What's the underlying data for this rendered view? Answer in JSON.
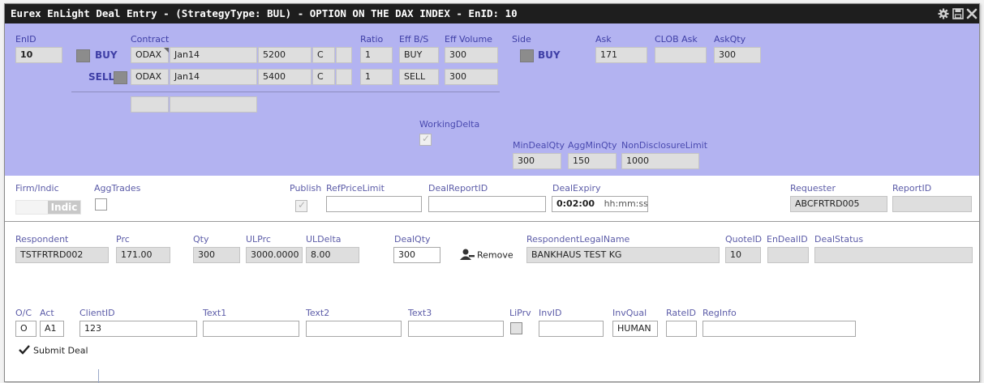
{
  "window": {
    "title": "Eurex EnLight Deal Entry - (StrategyType: BUL) - OPTION ON THE DAX INDEX - EnID: 10",
    "icons": [
      "gear-icon",
      "save-icon",
      "close-icon"
    ]
  },
  "header": {
    "enid_label": "EnID",
    "enid_value": "10",
    "contract_label": "Contract",
    "ratio_label": "Ratio",
    "effbs_label": "Eff B/S",
    "effvol_label": "Eff Volume",
    "side_label": "Side",
    "ask_label": "Ask",
    "clobask_label": "CLOB Ask",
    "askqty_label": "AskQty",
    "buy_label": "BUY",
    "sell_label": "SELL",
    "side_value": "BUY",
    "ask_value": "171",
    "clobask_value": "",
    "askqty_value": "300"
  },
  "legs": [
    {
      "product": "ODAX",
      "expiry": "Jan14",
      "strike": "5200",
      "cp": "C",
      "extra": "",
      "ratio": "1",
      "effbs": "BUY",
      "effvol": "300"
    },
    {
      "product": "ODAX",
      "expiry": "Jan14",
      "strike": "5400",
      "cp": "C",
      "extra": "",
      "ratio": "1",
      "effbs": "SELL",
      "effvol": "300"
    }
  ],
  "working_delta": {
    "label": "WorkingDelta",
    "checked": true
  },
  "limits": {
    "mindealqty_label": "MinDealQty",
    "aggminqty_label": "AggMinQty",
    "nondisc_label": "NonDisclosureLimit",
    "mindealqty": "300",
    "aggminqty": "150",
    "nondisc": "1000"
  },
  "firm": {
    "firm_indic_label": "Firm/Indic",
    "indic_value": "Indic",
    "aggtrades_label": "AggTrades",
    "publish_label": "Publish",
    "refpricelimit_label": "RefPriceLimit",
    "refpricelimit": "",
    "dealreportid_label": "DealReportID",
    "dealreportid": "",
    "dealexpiry_label": "DealExpiry",
    "dealexpiry_value": "0:02:00",
    "dealexpiry_format": "hh:mm:ss",
    "requester_label": "Requester",
    "requester": "ABCFRTRD005",
    "reportid_label": "ReportID",
    "reportid": ""
  },
  "respondent": {
    "respondent_label": "Respondent",
    "respondent": "TSTFRTRD002",
    "prc_label": "Prc",
    "prc": "171.00",
    "qty_label": "Qty",
    "qty": "300",
    "ulprc_label": "ULPrc",
    "ulprc": "3000.0000",
    "uldelta_label": "ULDelta",
    "uldelta": "8.00",
    "dealqty_label": "DealQty",
    "dealqty": "300",
    "remove_label": "Remove",
    "legalname_label": "RespondentLegalName",
    "legalname": "BANKHAUS TEST KG",
    "quoteid_label": "QuoteID",
    "quoteid": "10",
    "endealid_label": "EnDealID",
    "endealid": "",
    "dealstatus_label": "DealStatus",
    "dealstatus": ""
  },
  "order": {
    "oc_label": "O/C",
    "oc": "O",
    "act_label": "Act",
    "act": "A1",
    "clientid_label": "ClientID",
    "clientid": "123",
    "text1_label": "Text1",
    "text1": "",
    "text2_label": "Text2",
    "text2": "",
    "text3_label": "Text3",
    "text3": "",
    "liprv_label": "LiPrv",
    "invid_label": "InvID",
    "invid": "",
    "invqual_label": "InvQual",
    "invqual": "HUMAN",
    "rateid_label": "RateID",
    "rateid": "",
    "reginfo_label": "RegInfo",
    "reginfo": ""
  },
  "submit_label": "Submit Deal",
  "colors": {
    "top_panel": "#b3b3f1",
    "title_bar": "#1e1e1e",
    "label_blue": "#3f3fa6"
  }
}
